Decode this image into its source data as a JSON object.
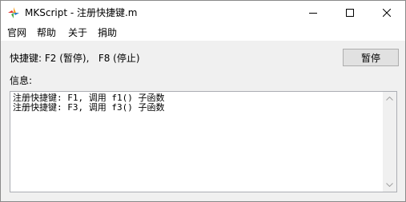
{
  "window": {
    "title": "MKScript - 注册快捷键.m",
    "controls": {
      "minimize_icon": "minimize-icon",
      "maximize_icon": "maximize-icon",
      "close_icon": "close-icon"
    }
  },
  "menu": {
    "items": [
      {
        "label": "官网"
      },
      {
        "label": "帮助"
      },
      {
        "label": "关于"
      },
      {
        "label": "捐助"
      }
    ]
  },
  "hotkeys": {
    "label": "快捷键: F2 (暂停),   F8 (停止)"
  },
  "pause_button": {
    "label": "暂停"
  },
  "info": {
    "label": "信息:",
    "lines": [
      "注册快捷键: F1, 调用 f1() 子函数",
      "注册快捷键: F3, 调用 f3() 子函数"
    ]
  },
  "colors": {
    "titlebar_bg": "#ffffff",
    "client_bg": "#f0f0f0",
    "button_bg": "#e1e1e1",
    "icon_orange": "#f7a325",
    "icon_blue": "#2d7fc8",
    "icon_green": "#4caf50",
    "icon_red": "#e53935"
  }
}
